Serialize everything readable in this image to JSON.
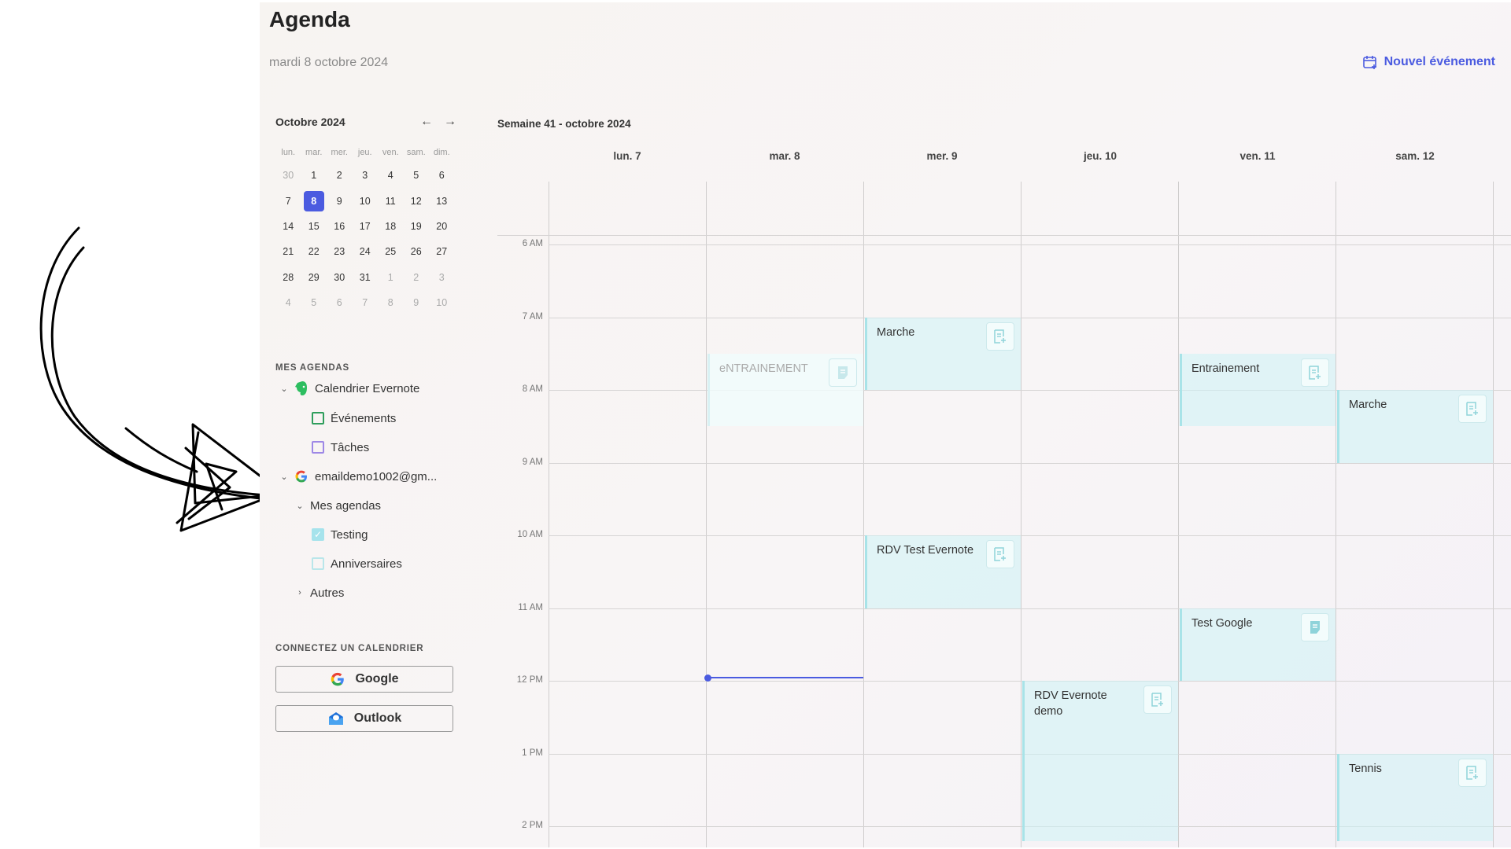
{
  "app": {
    "title": "Agenda",
    "date": "mardi 8 octobre 2024",
    "new_event_label": "Nouvel événement",
    "accent": "#4b5be0"
  },
  "mini_calendar": {
    "month_label": "Octobre 2024",
    "prev_icon": "arrow-left-icon",
    "next_icon": "arrow-right-icon",
    "weekdays": [
      "lun.",
      "mar.",
      "mer.",
      "jeu.",
      "ven.",
      "sam.",
      "dim."
    ],
    "weeks": [
      [
        "30",
        "1",
        "2",
        "3",
        "4",
        "5",
        "6"
      ],
      [
        "7",
        "8",
        "9",
        "10",
        "11",
        "12",
        "13"
      ],
      [
        "14",
        "15",
        "16",
        "17",
        "18",
        "19",
        "20"
      ],
      [
        "21",
        "22",
        "23",
        "24",
        "25",
        "26",
        "27"
      ],
      [
        "28",
        "29",
        "30",
        "31",
        "1",
        "2",
        "3"
      ],
      [
        "4",
        "5",
        "6",
        "7",
        "8",
        "9",
        "10"
      ]
    ],
    "selected": "8"
  },
  "my_calendars": {
    "heading": "MES AGENDAS",
    "evernote_account": "Calendrier Evernote",
    "evernote_events": "Événements",
    "evernote_tasks": "Tâches",
    "google_account": "emaildemo1002@gm...",
    "google_group": "Mes agendas",
    "testing": "Testing",
    "birthdays": "Anniversaires",
    "others": "Autres"
  },
  "connect": {
    "heading": "CONNECTEZ UN CALENDRIER",
    "google_label": "Google",
    "outlook_label": "Outlook"
  },
  "week": {
    "title": "Semaine 41 - octobre 2024",
    "days": [
      "lun. 7",
      "mar. 8",
      "mer. 9",
      "jeu. 10",
      "ven. 11",
      "sam. 12"
    ],
    "hours": [
      "6 AM",
      "7 AM",
      "8 AM",
      "9 AM",
      "10 AM",
      "11 AM",
      "12 PM",
      "1 PM",
      "2 PM"
    ]
  },
  "events": [
    {
      "title": "Marche",
      "day": 2,
      "start": 7,
      "end": 8,
      "faded": false,
      "note_icon": "note-add-icon"
    },
    {
      "title": "eNTRAINEMENT",
      "day": 1,
      "start": 7.5,
      "end": 8.5,
      "faded": true,
      "note_icon": "note-icon"
    },
    {
      "title": "Entrainement",
      "day": 4,
      "start": 7.5,
      "end": 8.5,
      "faded": false,
      "note_icon": "note-add-icon"
    },
    {
      "title": "Marche",
      "day": 5,
      "start": 8,
      "end": 9,
      "faded": false,
      "note_icon": "note-add-icon"
    },
    {
      "title": "RDV Test Evernote",
      "day": 2,
      "start": 10,
      "end": 11,
      "faded": false,
      "note_icon": "note-add-icon"
    },
    {
      "title": "Test Google",
      "day": 4,
      "start": 11,
      "end": 12,
      "faded": false,
      "note_icon": "note-icon"
    },
    {
      "title": "RDV Evernote demo",
      "day": 3,
      "start": 12,
      "end": 14.2,
      "faded": false,
      "note_icon": "note-add-icon"
    },
    {
      "title": "Tennis",
      "day": 5,
      "start": 13,
      "end": 14.2,
      "faded": false,
      "note_icon": "note-add-icon"
    }
  ],
  "current_time": {
    "day": 1,
    "hour": 11.95
  }
}
